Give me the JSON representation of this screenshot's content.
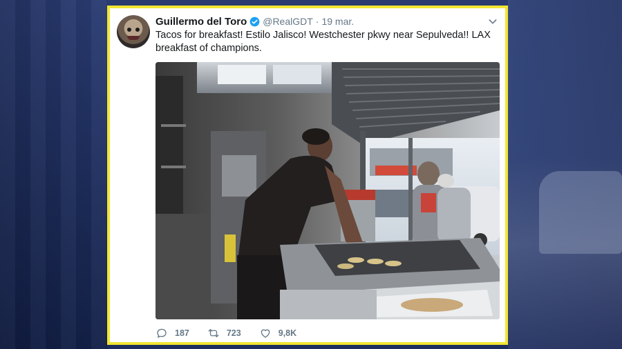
{
  "tweet": {
    "display_name": "Guillermo del Toro",
    "handle": "@RealGDT",
    "separator": "·",
    "date": "19 mar.",
    "text": "Tacos for breakfast!  Estilo Jalisco! Westchester pkwy near Sepulveda!! LAX breakfast of champions.",
    "accent_color": "#1da1f2",
    "frame_color": "#f2e533"
  },
  "actions": {
    "reply_count": "187",
    "retweet_count": "723",
    "like_count": "9,8K",
    "reply_icon": "reply-icon",
    "retweet_icon": "retweet-icon",
    "like_icon": "heart-icon"
  }
}
